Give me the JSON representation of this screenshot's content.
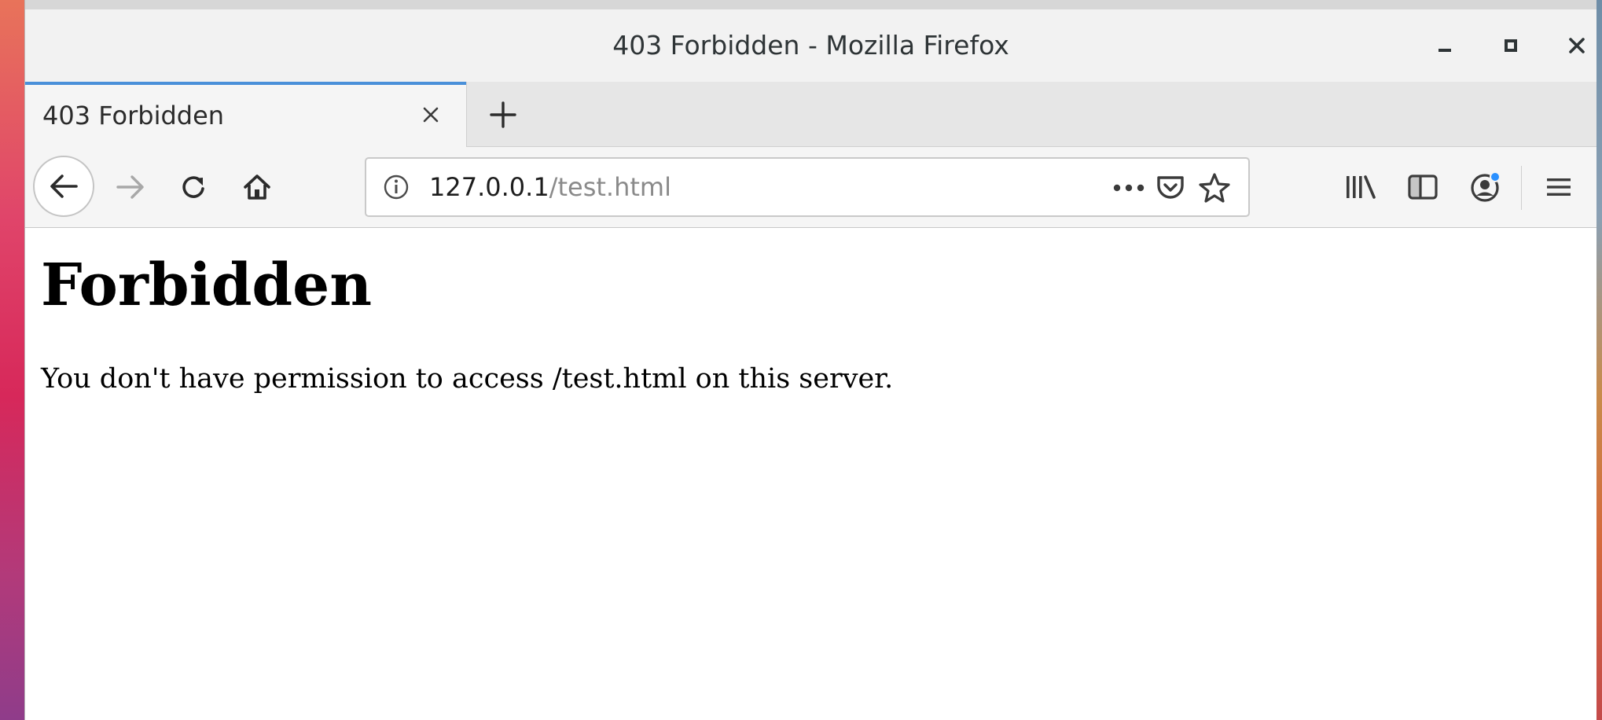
{
  "window": {
    "title": "403 Forbidden - Mozilla Firefox"
  },
  "tabs": [
    {
      "label": "403 Forbidden",
      "active": true
    }
  ],
  "urlbar": {
    "host": "127.0.0.1",
    "path": "/test.html"
  },
  "page": {
    "heading": "Forbidden",
    "message": "You don't have permission to access /test.html on this server."
  },
  "icons": {
    "minimize": "minimize-icon",
    "maximize": "maximize-icon",
    "close": "close-icon",
    "tab_close": "close-icon",
    "new_tab": "plus-icon",
    "back": "arrow-left-icon",
    "forward": "arrow-right-icon",
    "reload": "reload-icon",
    "home": "home-icon",
    "site_info": "info-icon",
    "page_actions": "ellipsis-icon",
    "pocket": "pocket-icon",
    "bookmark": "star-icon",
    "library": "library-icon",
    "sidebar": "sidebar-icon",
    "account": "account-icon",
    "menu": "hamburger-menu-icon"
  },
  "colors": {
    "tab_accent": "#4a90d9",
    "account_badge": "#2a90ff"
  }
}
